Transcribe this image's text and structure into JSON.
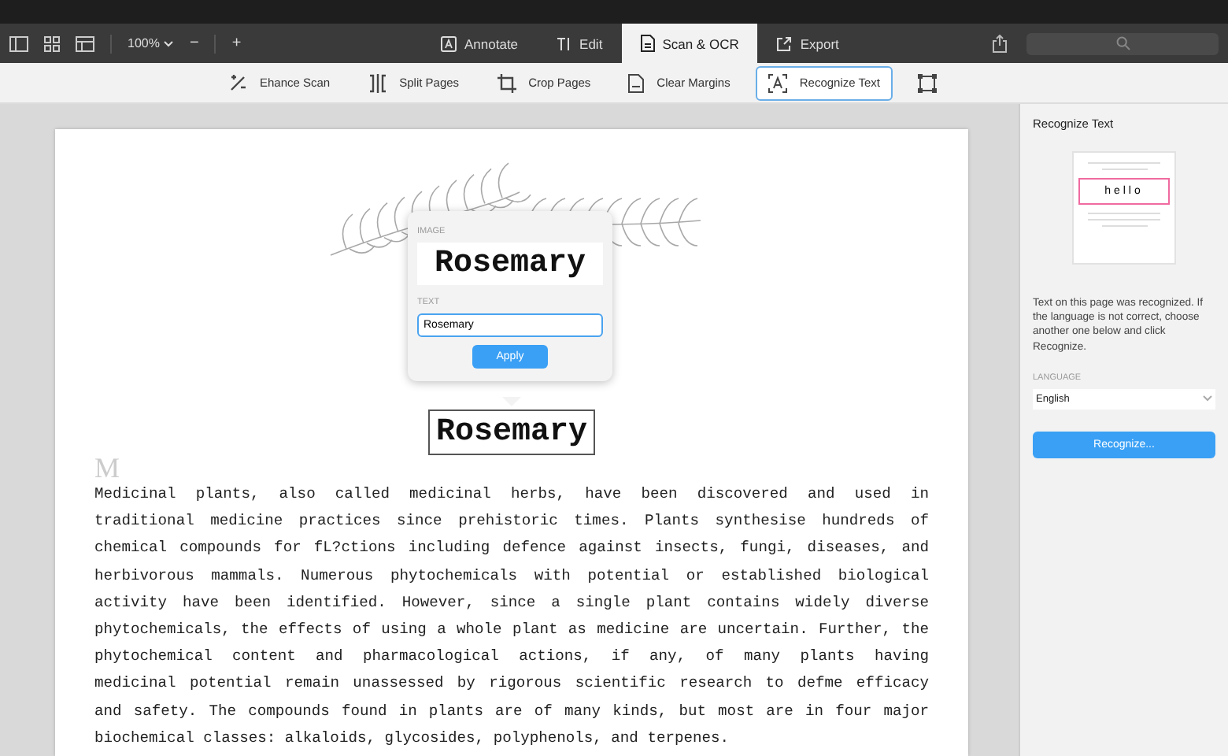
{
  "toolbar": {
    "zoom": "100%",
    "zoom_out": "−",
    "zoom_in": "+"
  },
  "tabs": [
    {
      "label": "Annotate",
      "selected": false
    },
    {
      "label": "Edit",
      "selected": false
    },
    {
      "label": "Scan & OCR",
      "selected": true
    },
    {
      "label": "Export",
      "selected": false
    }
  ],
  "tools": [
    {
      "label": "Ehance Scan",
      "selected": false
    },
    {
      "label": "Split Pages",
      "selected": false
    },
    {
      "label": "Crop Pages",
      "selected": false
    },
    {
      "label": "Clear Margins",
      "selected": false
    },
    {
      "label": "Recognize Text",
      "selected": true
    },
    {
      "selected": false
    }
  ],
  "popover": {
    "image_label": "IMAGE",
    "image_text": "Rosemary",
    "text_label": "TEXT",
    "value": "Rosemary",
    "button": "Apply"
  },
  "page": {
    "title": "Rosemary",
    "ghost_initial": "M",
    "lines": [
      "Medicinal plants, also called medicinal herbs, have been discovered and used in",
      "traditional medicine practices since prehistoric times. Plants synthesise hundreds of",
      "chemical compounds for fL?ctions including defence against insects, fungi, diseases, and",
      "herbivorous mammals. Numerous phytochemicals with potential or established biological",
      "activity have been identified. However, since a single plant contains widely diverse",
      "phytochemicals, the effects of using a whole plant as medicine are uncertain. Further, the",
      "phytochemical content and pharmacological actions, if any, of many plants having",
      "medicinal potential remain unassessed by rigorous scientific research to defme efficacy",
      "and safety. The compounds found in plants are of many kinds, but most are in four major",
      "biochemical classes: alkaloids, glycosides, polyphenols, and terpenes."
    ]
  },
  "panel": {
    "title": "Recognize Text",
    "sample_word": "hello",
    "description": "Text on this page was recognized. If the language is not correct, choose another one below and click Recognize.",
    "language_label": "LANGUAGE",
    "language": "English",
    "button": "Recognize..."
  }
}
